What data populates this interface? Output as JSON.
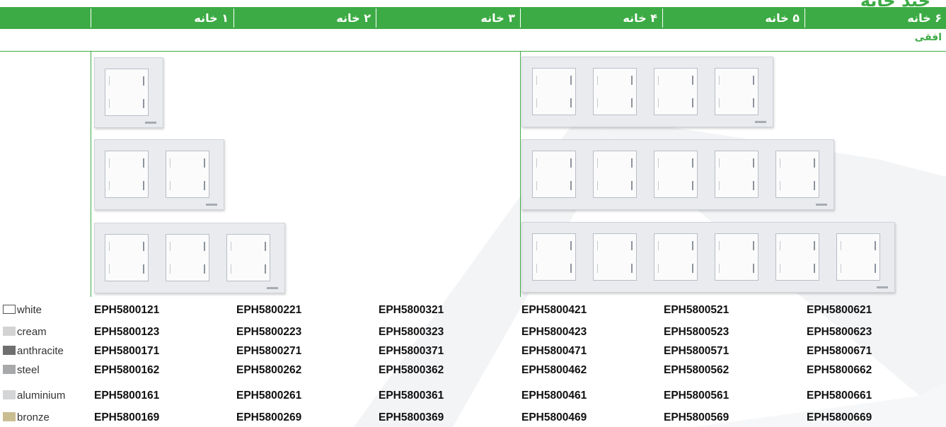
{
  "title_fragment": "چند خانه",
  "header": {
    "columns": [
      "۶ خانه",
      "۵ خانه",
      "۴ خانه",
      "۳ خانه",
      "۲ خانه",
      "۱ خانه"
    ]
  },
  "subheader": "افقی",
  "colors": {
    "accent": "#3dab45",
    "frame": "#e9ebee"
  },
  "rows": [
    {
      "color_name": "white",
      "swatch": "#ffffff",
      "codes": [
        "EPH5800121",
        "EPH5800221",
        "EPH5800321",
        "EPH5800421",
        "EPH5800521",
        "EPH5800621"
      ]
    },
    {
      "color_name": "cream",
      "swatch": "#d3d3d3",
      "codes": [
        "EPH5800123",
        "EPH5800223",
        "EPH5800323",
        "EPH5800423",
        "EPH5800523",
        "EPH5800623"
      ]
    },
    {
      "color_name": "anthracite",
      "swatch": "#6f6f70",
      "codes": [
        "EPH5800171",
        "EPH5800271",
        "EPH5800371",
        "EPH5800471",
        "EPH5800571",
        "EPH5800671"
      ]
    },
    {
      "color_name": "steel",
      "swatch": "#a8a9ab",
      "codes": [
        "EPH5800162",
        "EPH5800262",
        "EPH5800362",
        "EPH5800462",
        "EPH5800562",
        "EPH5800662"
      ]
    },
    {
      "color_name": "aluminium",
      "swatch": "#d4d5d7",
      "codes": [
        "EPH5800161",
        "EPH5800261",
        "EPH5800361",
        "EPH5800461",
        "EPH5800561",
        "EPH5800661"
      ]
    },
    {
      "color_name": "bronze",
      "swatch": "#cbbd92",
      "codes": [
        "EPH5800169",
        "EPH5800269",
        "EPH5800369",
        "EPH5800469",
        "EPH5800569",
        "EPH5800669"
      ]
    }
  ]
}
